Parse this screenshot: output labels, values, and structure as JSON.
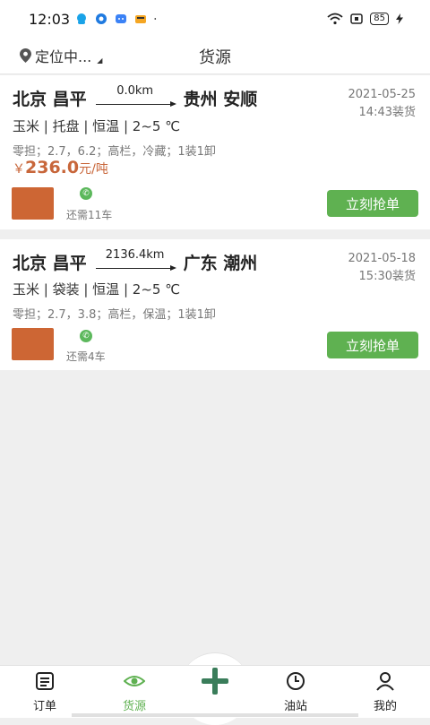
{
  "status_bar": {
    "time": "12:03",
    "battery": "85"
  },
  "header": {
    "location": "定位中...",
    "title": "货源"
  },
  "cards": [
    {
      "from": "北京 昌平",
      "distance": "0.0km",
      "to": "贵州 安顺",
      "date": "2021-05-25",
      "load_time": "14:43装货",
      "goods": "玉米 | 托盘 | 恒温 | 2~5 ℃",
      "detail": "零担；2.7，6.2；高栏，冷藏；1装1卸",
      "price_symbol": "￥",
      "price": "236.0",
      "price_unit": "元/吨",
      "remaining": "还需11车",
      "grab_label": "立刻抢单"
    },
    {
      "from": "北京 昌平",
      "distance": "2136.4km",
      "to": "广东 潮州",
      "date": "2021-05-18",
      "load_time": "15:30装货",
      "goods": "玉米 | 袋装 | 恒温 | 2~5 ℃",
      "detail": "零担；2.7，3.8；高栏，保温；1装1卸",
      "remaining": "还需4车",
      "grab_label": "立刻抢单"
    }
  ],
  "tabbar": {
    "orders": "订单",
    "cargo": "货源",
    "gas": "油站",
    "mine": "我的"
  },
  "colors": {
    "accent": "#5fb151",
    "price": "#c8663a",
    "avatar": "#cd6634"
  }
}
